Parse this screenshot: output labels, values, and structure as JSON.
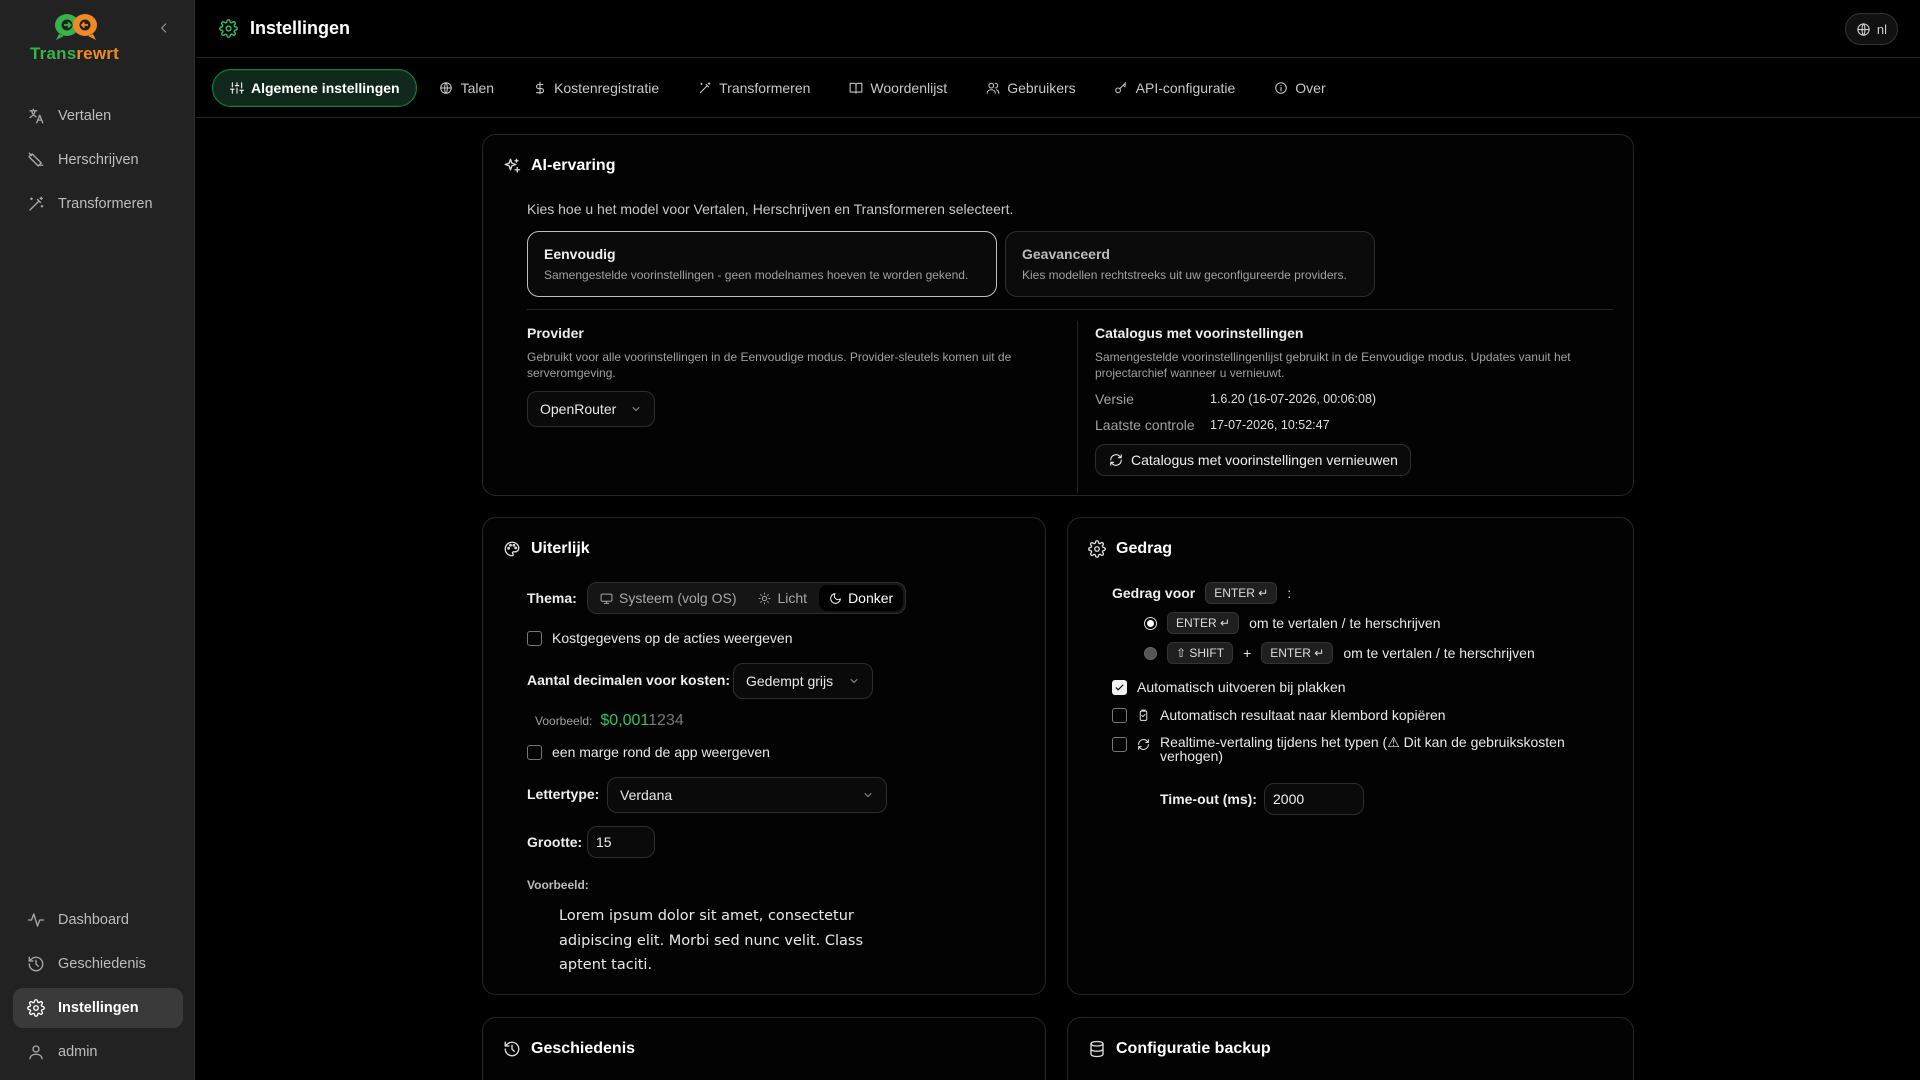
{
  "app": {
    "logo_text_1": "Trans",
    "logo_text_2": "rewrt"
  },
  "sidebar": {
    "items": [
      {
        "label": "Vertalen"
      },
      {
        "label": "Herschrijven"
      },
      {
        "label": "Transformeren"
      }
    ],
    "bottom_items": [
      {
        "label": "Dashboard"
      },
      {
        "label": "Geschiedenis"
      },
      {
        "label": "Instellingen"
      },
      {
        "label": "admin"
      }
    ]
  },
  "header": {
    "title": "Instellingen",
    "lang": "nl"
  },
  "tabs": [
    {
      "label": "Algemene instellingen"
    },
    {
      "label": "Talen"
    },
    {
      "label": "Kostenregistratie"
    },
    {
      "label": "Transformeren"
    },
    {
      "label": "Woordenlijst"
    },
    {
      "label": "Gebruikers"
    },
    {
      "label": "API-configuratie"
    },
    {
      "label": "Over"
    }
  ],
  "ai": {
    "title": "AI-ervaring",
    "subtitle": "Kies hoe u het model voor Vertalen, Herschrijven en Transformeren selecteert.",
    "modes": [
      {
        "title": "Eenvoudig",
        "desc": "Samengestelde voorinstellingen - geen modelnames hoeven te worden gekend."
      },
      {
        "title": "Geavanceerd",
        "desc": "Kies modellen rechtstreeks uit uw geconfigureerde providers."
      }
    ],
    "provider": {
      "label": "Provider",
      "desc": "Gebruikt voor alle voorinstellingen in de Eenvoudige modus. Provider-sleutels komen uit de serveromgeving.",
      "value": "OpenRouter"
    },
    "catalog": {
      "label": "Catalogus met voorinstellingen",
      "desc": "Samengestelde voorinstellingenlijst gebruikt in de Eenvoudige modus. Updates vanuit het projectarchief wanneer u vernieuwt.",
      "version_label": "Versie",
      "version_value": "1.6.20 (16-07-2026, 00:06:08)",
      "check_label": "Laatste controle",
      "check_value": "17-07-2026, 10:52:47",
      "refresh_label": "Catalogus met voorinstellingen vernieuwen"
    }
  },
  "appearance": {
    "title": "Uiterlijk",
    "theme_label": "Thema:",
    "theme_options": [
      "Systeem (volg OS)",
      "Licht",
      "Donker"
    ],
    "theme_selected": "Donker",
    "show_costs_label": "Kostgegevens op de acties weergeven",
    "show_costs": false,
    "decimals_label": "Aantal decimalen voor kosten:",
    "decimals_value": "Gedempt grijs",
    "example_label": "Voorbeeld:",
    "example_bright": "$0,001",
    "example_dim": "1234",
    "margin_label": "een marge rond de app weergeven",
    "margin": false,
    "font_label": "Lettertype:",
    "font_value": "Verdana",
    "size_label": "Grootte:",
    "size_value": "15",
    "preview_label": "Voorbeeld:",
    "preview_text": "Lorem ipsum dolor sit amet, consectetur adipiscing elit. Morbi sed nunc velit. Class aptent taciti."
  },
  "behavior": {
    "title": "Gedrag",
    "enter_label": "Gedrag voor",
    "enter_key": "ENTER ↵",
    "colon": ":",
    "opt1_key": "ENTER ↵",
    "opt1_text": "om te vertalen / te herschrijven",
    "opt2_key1": "⇧ SHIFT",
    "opt2_plus": "+",
    "opt2_key2": "ENTER ↵",
    "opt2_text": "om te vertalen / te herschrijven",
    "auto_run_label": "Automatisch uitvoeren bij plakken",
    "auto_run": true,
    "auto_copy_label": "Automatisch resultaat naar klembord kopiëren",
    "auto_copy": false,
    "realtime_label": "Realtime-vertaling tijdens het typen (⚠ Dit kan de gebruikskosten verhogen)",
    "realtime": false,
    "timeout_label": "Time-out (ms):",
    "timeout_value": "2000"
  },
  "history_card": {
    "title": "Geschiedenis"
  },
  "backup_card": {
    "title": "Configuratie backup"
  },
  "colors": {
    "accent": "#2fc268",
    "brand_green": "#38b24a",
    "brand_orange": "#f08a24"
  }
}
